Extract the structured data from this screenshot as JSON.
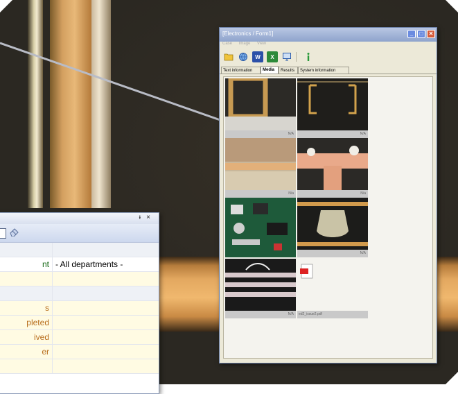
{
  "window": {
    "title": "[Electronics / Form1]",
    "menu": [
      "Case",
      "Image",
      "View"
    ],
    "toolbar": [
      {
        "icon": "folder-icon"
      },
      {
        "icon": "browser-icon"
      },
      {
        "icon": "word-icon",
        "label": "W"
      },
      {
        "icon": "excel-icon",
        "label": "X"
      },
      {
        "icon": "monitor-icon"
      },
      {
        "icon": "info-icon"
      }
    ],
    "tabs": [
      "Text information",
      "Media",
      "Results",
      "System information"
    ],
    "active_tab": "Media",
    "thumbnails": [
      {
        "caption": "N/A"
      },
      {
        "caption": "N/A"
      },
      {
        "caption": "N/a"
      },
      {
        "caption": "N/a"
      },
      {
        "caption": ""
      },
      {
        "caption": "N/A"
      },
      {
        "caption": "N/A"
      },
      {
        "caption": "ed2_issue2.pdf"
      }
    ],
    "controls": {
      "minimize": "_",
      "maximize": "□",
      "close": "✕"
    }
  },
  "panel": {
    "pin": "ᵼ",
    "close_glyph": "×",
    "rows": [
      {
        "key": "",
        "value": "",
        "style": "section"
      },
      {
        "key": "nt",
        "value": "- All departments -",
        "style": "green"
      },
      {
        "key": "",
        "value": "",
        "style": "yellow"
      },
      {
        "key": "",
        "value": "",
        "style": "section"
      },
      {
        "key": "s",
        "value": "",
        "style": "yellow"
      },
      {
        "key": "pleted",
        "value": "",
        "style": "yellow"
      },
      {
        "key": "ived",
        "value": "",
        "style": "yellow"
      },
      {
        "key": "er",
        "value": "",
        "style": "yellow"
      },
      {
        "key": "",
        "value": "",
        "style": "yellow"
      }
    ]
  }
}
